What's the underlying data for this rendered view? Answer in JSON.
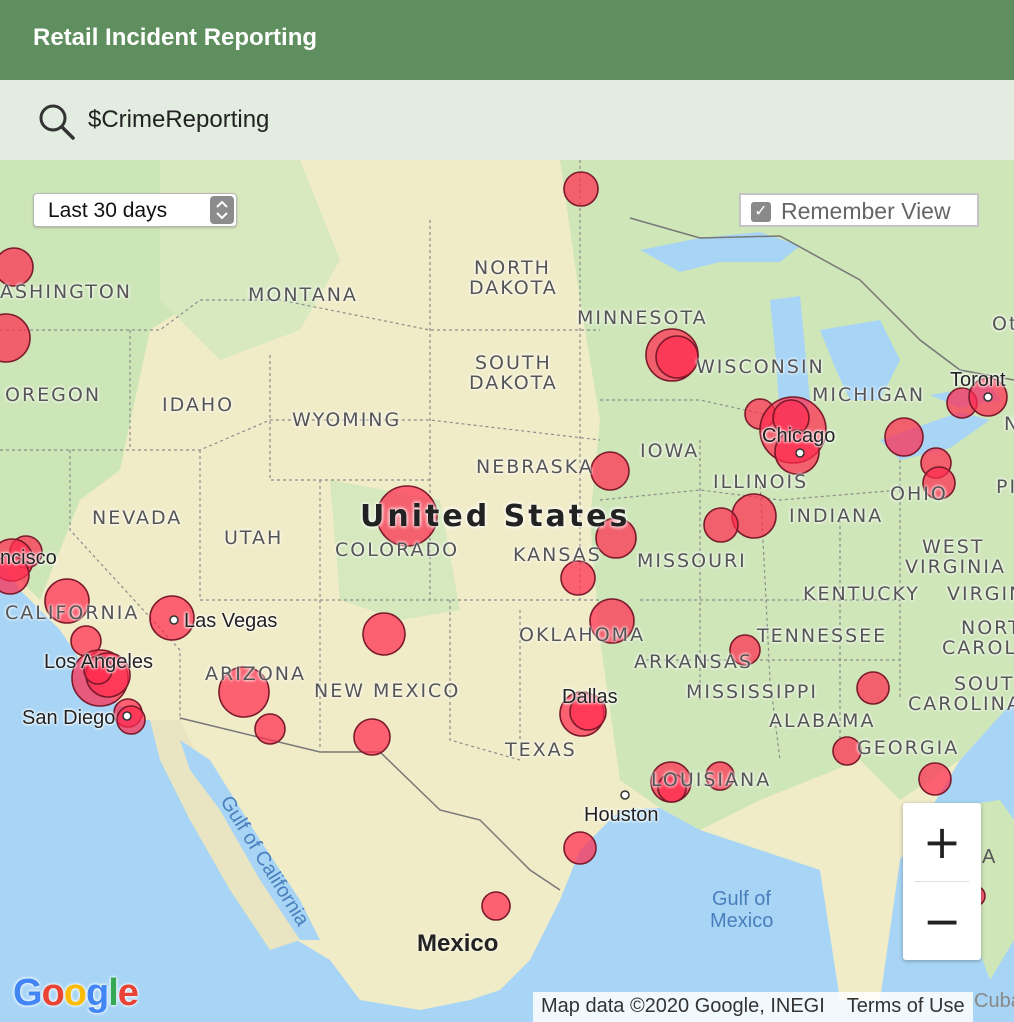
{
  "header": {
    "title": "Retail Incident Reporting"
  },
  "search": {
    "value": "$CrimeReporting",
    "icon": "search-icon"
  },
  "controls": {
    "range_value": "Last 30 days",
    "remember_label": "Remember View",
    "remember_checked": true,
    "zoom_in_label": "+",
    "zoom_out_label": "−"
  },
  "map": {
    "country_label": "United States",
    "state_labels": [
      "ASHINGTON",
      "MONTANA",
      "NORTH",
      "DAKOTA",
      "MINNESOTA",
      "SOUTH",
      "DAKOTA",
      "WISCONSIN",
      "MICHIGAN",
      "OREGON",
      "IDAHO",
      "WYOMING",
      "IOWA",
      "NEBRASKA",
      "ILLINOIS",
      "OHIO",
      "NEVADA",
      "UTAH",
      "COLORADO",
      "KANSAS",
      "INDIANA",
      "MISSOURI",
      "WEST",
      "VIRGINIA",
      "KENTUCKY",
      "VIRGIN",
      "CALIFORNIA",
      "OKLAHOMA",
      "TENNESSEE",
      "NORT",
      "CAROL",
      "ARIZONA",
      "NEW MEXICO",
      "ARKANSAS",
      "MISSISSIPPI",
      "SOUTH",
      "CAROLINA",
      "ALABAMA",
      "GEORGIA",
      "TEXAS",
      "LOUISIANA",
      "PI",
      "N",
      "Ot"
    ],
    "city_labels": [
      "Toront",
      "Chicago",
      "ncisco",
      "Las Vegas",
      "Los Angeles",
      "San Diego",
      "Dallas",
      "Houston"
    ],
    "water_labels": [
      "Gulf of California",
      "Gulf of",
      "Mexico",
      "Cuba",
      "A"
    ],
    "mexico_label": "Mexico",
    "attribution_data": "Map data ©2020 Google, INEGI",
    "attribution_terms": "Terms of Use",
    "logo_text": "Google"
  },
  "colors": {
    "header": "#5f8f5e",
    "searchbar": "#e2ece0",
    "marker": "#ff2b4f",
    "land": "#f1ecc8",
    "forest": "#cde6b7",
    "water": "#a8d5f5"
  }
}
